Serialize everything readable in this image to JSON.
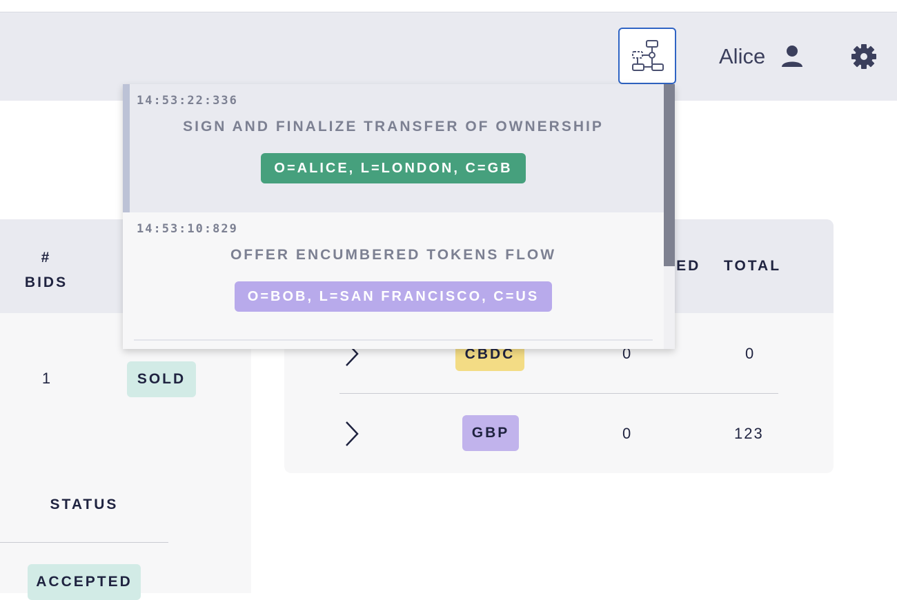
{
  "header": {
    "user_name": "Alice",
    "icons": {
      "flows": "flow-diagram-icon",
      "user": "user-icon",
      "settings": "gear-icon"
    }
  },
  "left_table": {
    "bids_header_line1": "#",
    "bids_header_line2": "BIDS",
    "bids_value": "1",
    "sold_badge": "SOLD",
    "status_header": "STATUS",
    "accepted_badge": "ACCEPTED"
  },
  "balances": {
    "col_encumbered_partial": "RED",
    "col_total": "TOTAL",
    "rows": [
      {
        "currency": "CBDC",
        "encumbered": "0",
        "total": "0",
        "badge_color": "#f3dc85"
      },
      {
        "currency": "GBP",
        "encumbered": "0",
        "total": "123",
        "badge_color": "#c1b3ec"
      }
    ]
  },
  "flows_dropdown": {
    "items": [
      {
        "timestamp": "14:53:22:336",
        "title": "SIGN AND FINALIZE TRANSFER OF OWNERSHIP",
        "party": "O=ALICE, L=LONDON, C=GB",
        "party_color": "#46a07d"
      },
      {
        "timestamp": "14:53:10:829",
        "title": "OFFER ENCUMBERED TOKENS FLOW",
        "party": "O=BOB, L=SAN FRANCISCO, C=US",
        "party_color": "#b8aaeb"
      }
    ]
  }
}
